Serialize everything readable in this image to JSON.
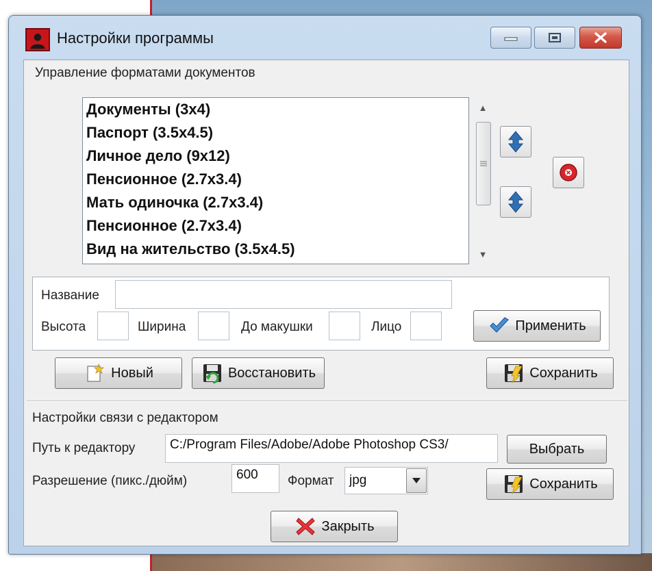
{
  "window": {
    "title": "Настройки программы"
  },
  "formats": {
    "group_label": "Управление форматами документов",
    "items": [
      "Документы (3x4)",
      "Паспорт (3.5x4.5)",
      "Личное дело (9x12)",
      "Пенсионное (2.7x3.4)",
      "Мать одиночка (2.7x3.4)",
      "Пенсионное (2.7x3.4)",
      "Вид на жительство (3.5x4.5)"
    ],
    "name_label": "Название",
    "name_value": "",
    "height_label": "Высота",
    "height_value": "",
    "width_label": "Ширина",
    "width_value": "",
    "crown_label": "До макушки",
    "crown_value": "",
    "face_label": "Лицо",
    "face_value": "",
    "apply_label": "Применить",
    "new_label": "Новый",
    "restore_label": "Восстановить",
    "save_label": "Сохранить"
  },
  "editor": {
    "group_label": "Настройки связи с редактором",
    "path_label": "Путь к редактору",
    "path_value": "C:/Program Files/Adobe/Adobe Photoshop CS3/",
    "browse_label": "Выбрать",
    "resolution_label": "Разрешение (пикс./дюйм)",
    "resolution_value": "600",
    "format_label": "Формат",
    "format_value": "jpg",
    "save_label": "Сохранить"
  },
  "footer": {
    "close_label": "Закрыть"
  },
  "colors": {
    "titlebar": "#bcd2ea",
    "close_button": "#c23a2b",
    "icon_blue": "#2f6fb5",
    "delete_red": "#d7262c"
  },
  "icons": {
    "app": "portrait-icon",
    "move_up": "arrow-up-icon",
    "move_down": "arrow-down-icon",
    "delete": "delete-icon",
    "apply": "checkmark-icon",
    "new": "new-document-icon",
    "restore": "floppy-restore-icon",
    "save": "floppy-save-icon",
    "close": "red-x-icon"
  }
}
